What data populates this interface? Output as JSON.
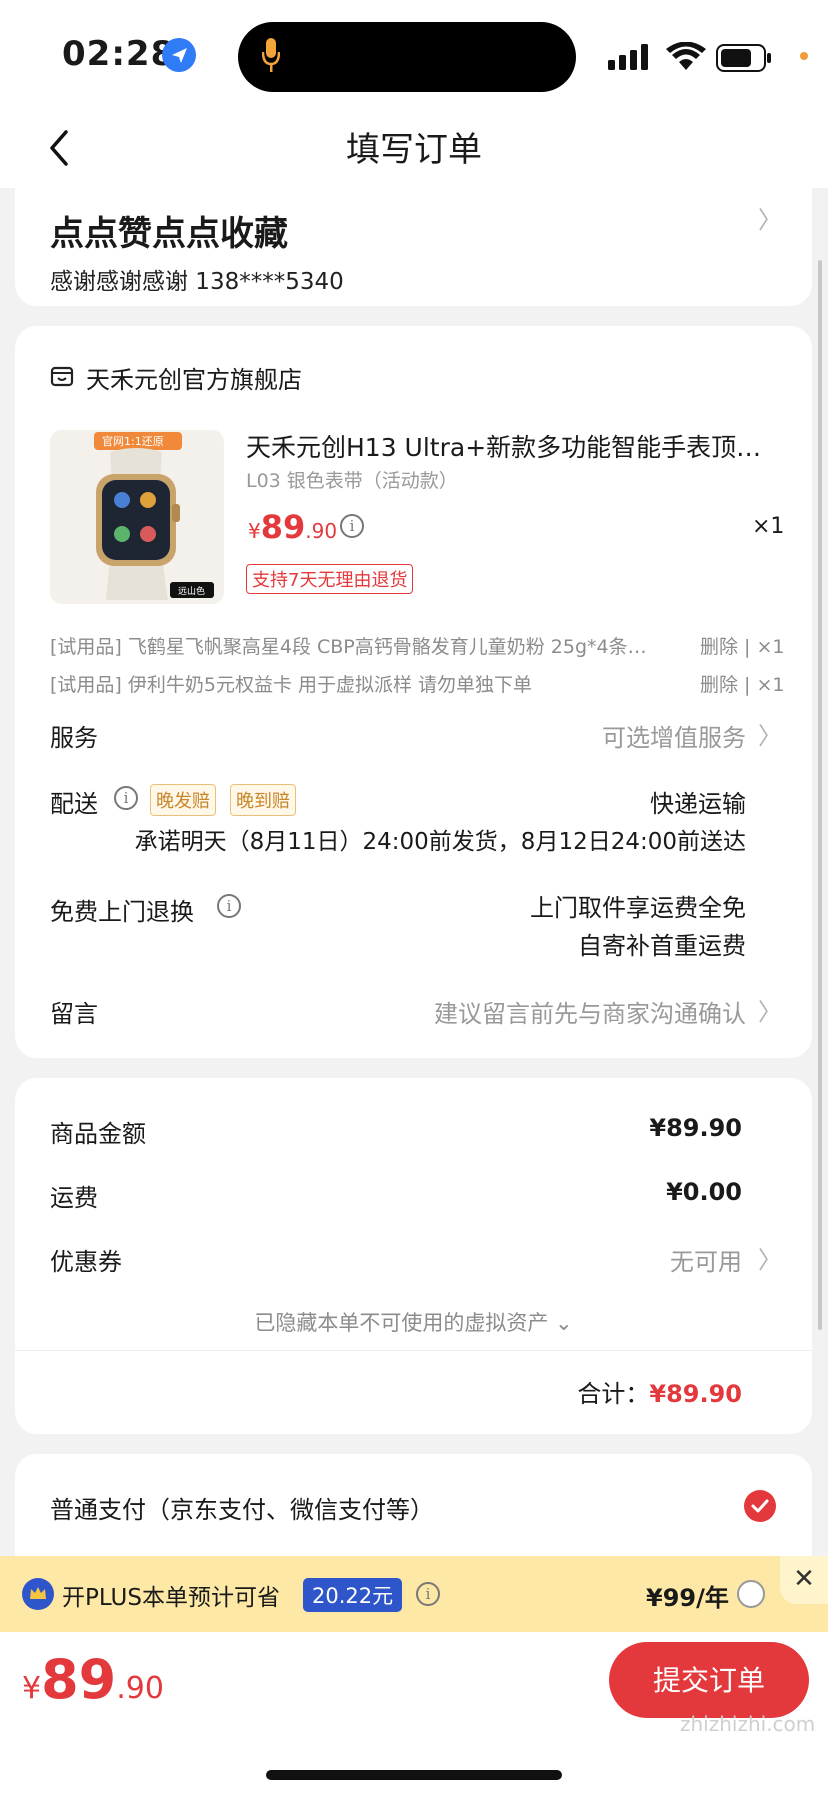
{
  "status_bar": {
    "time": "02:28"
  },
  "header": {
    "title": "填写订单"
  },
  "address": {
    "name": "点点赞点点收藏",
    "detail": "感谢感谢感谢  138****5340",
    "chevron": "〉"
  },
  "shop": {
    "name": "天禾元创官方旗舰店"
  },
  "product": {
    "image_badge": "官网1:1还原",
    "image_tag": "远山色",
    "title": "天禾元创H13 Ultra+新款多功能智能手表顶…",
    "spec": "L03 银色表带（活动款）",
    "price_symbol": "¥",
    "price_int": "89",
    "price_dec": ".90",
    "quantity": "×1",
    "return_tag": "支持7天无理由退货"
  },
  "trial_items": [
    {
      "text": "[试用品] 飞鹤星飞帆聚高星4段 CBP高钙骨骼发育儿童奶粉 25g*4条…",
      "action": "删除 | ×1"
    },
    {
      "text": "[试用品] 伊利牛奶5元权益卡 用于虚拟派样 请勿单独下单",
      "action": "删除 | ×1"
    }
  ],
  "service": {
    "label": "服务",
    "value": "可选增值服务"
  },
  "delivery": {
    "label": "配送",
    "badges": [
      "晚发赔",
      "晚到赔"
    ],
    "method": "快递运输",
    "promise": "承诺明天（8月11日）24:00前发货，8月12日24:00前送达"
  },
  "free_return": {
    "label": "免费上门退换",
    "line1": "上门取件享运费全免",
    "line2": "自寄补首重运费"
  },
  "message": {
    "label": "留言",
    "placeholder": "建议留言前先与商家沟通确认"
  },
  "summary": {
    "goods_label": "商品金额",
    "goods_value": "¥89.90",
    "shipping_label": "运费",
    "shipping_value": "¥0.00",
    "coupon_label": "优惠券",
    "coupon_value": "无可用",
    "hidden_assets": "已隐藏本单不可使用的虚拟资产 ⌄",
    "total_label": "合计：",
    "total_value": "¥89.90"
  },
  "payment": {
    "label": "普通支付（京东支付、微信支付等）",
    "selected": true
  },
  "plus": {
    "text": "开PLUS本单预计可省",
    "save": "20.22元",
    "price": "¥99/年",
    "close": "✕"
  },
  "bottom": {
    "price_symbol": "¥",
    "price_int": "89",
    "price_dec": ".90",
    "submit": "提交订单"
  },
  "watermark": "zhizhizhi.com",
  "colors": {
    "accent": "#e4393c",
    "plus_blue": "#2e55c9",
    "plus_bg": "#fde8a6"
  }
}
